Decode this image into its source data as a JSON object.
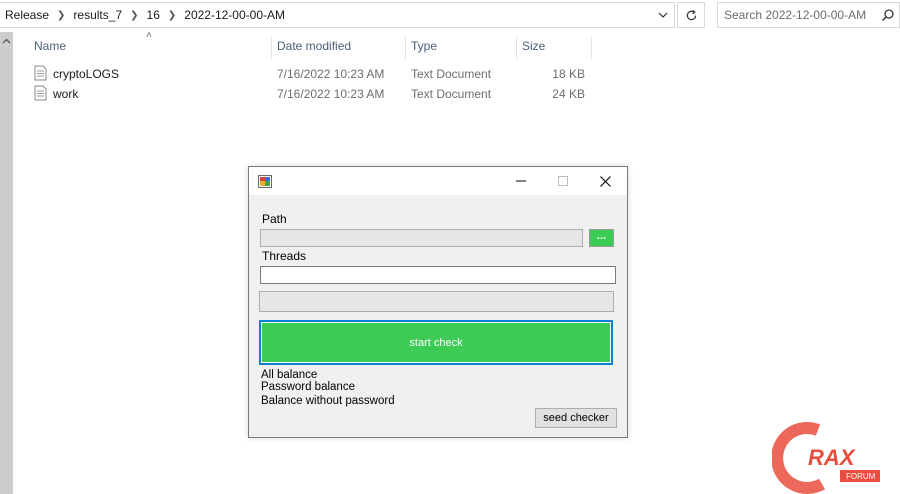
{
  "explorer": {
    "breadcrumb": [
      "Release",
      "results_7",
      "16",
      "2022-12-00-00-AM"
    ],
    "search_placeholder": "Search 2022-12-00-00-AM",
    "columns": {
      "name": "Name",
      "date": "Date modified",
      "type": "Type",
      "size": "Size"
    },
    "files": [
      {
        "name": "cryptoLOGS",
        "date": "7/16/2022 10:23 AM",
        "type": "Text Document",
        "size": "18 KB"
      },
      {
        "name": "work",
        "date": "7/16/2022 10:23 AM",
        "type": "Text Document",
        "size": "24 KB"
      }
    ]
  },
  "dialog": {
    "path_label": "Path",
    "browse_label": "...",
    "threads_label": "Threads",
    "path_value": "",
    "threads_value": "",
    "start_label": "start check",
    "balances": [
      "All balance",
      "Password balance",
      "Balance without password"
    ],
    "seed_label": "seed checker",
    "accent": "#3ccc56"
  },
  "watermark": {
    "text_main": "RAX",
    "text_sub": "FORUM"
  }
}
